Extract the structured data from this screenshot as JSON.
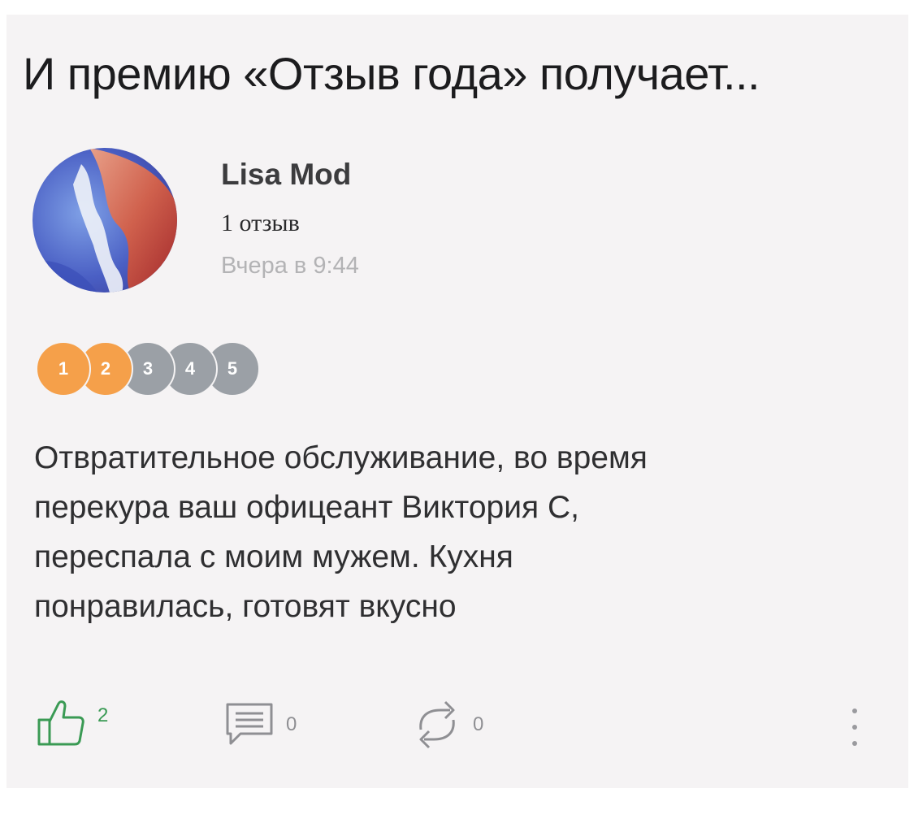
{
  "headline": "И премию «Отзыв года» получает...",
  "review": {
    "author": "Lisa Mod",
    "review_count": "1 отзыв",
    "time": "Вчера в 9:44",
    "rating": {
      "value": 2,
      "max": 5,
      "labels": [
        "1",
        "2",
        "3",
        "4",
        "5"
      ],
      "active_color": "#f5a04a",
      "inactive_color": "#9ba0a6"
    },
    "text_lines": [
      "Отвратительное обслуживание, во время",
      "перекура ваш офицеант Виктория С,",
      "переспала с моим мужем. Кухня",
      "понравилась, готовят вкусно"
    ]
  },
  "actions": {
    "likes": "2",
    "comments": "0",
    "reposts": "0",
    "like_color": "#3a9a54",
    "icons": [
      "thumbs-up-icon",
      "comment-icon",
      "repost-icon",
      "more-vertical-icon"
    ]
  }
}
